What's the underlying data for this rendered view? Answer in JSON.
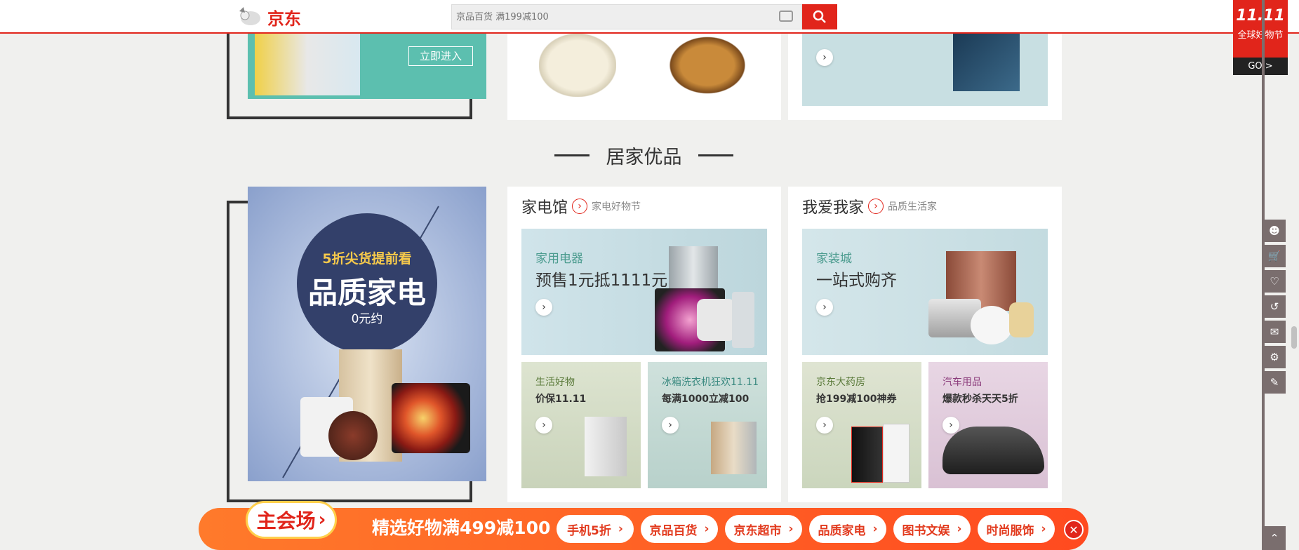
{
  "header": {
    "logo_text": "京东",
    "search_placeholder": "京品百货 满199减100",
    "camera_icon": "camera-icon",
    "search_icon": "search-icon"
  },
  "promo_corner": {
    "label": "全球好物节",
    "go": "GO >",
    "badge": "11.11"
  },
  "top_banner": {
    "enter_label": "立即进入"
  },
  "section": {
    "title": "居家优品"
  },
  "left_banner": {
    "line1": "5折尖货提前看",
    "line2": "品质家电",
    "line3": "0元约"
  },
  "panel_appliance": {
    "title": "家电馆",
    "subtitle": "家电好物节",
    "main": {
      "cat": "家用电器",
      "headline": "预售1元抵1111元"
    },
    "tiles": [
      {
        "cat": "生活好物",
        "headline": "价保11.11"
      },
      {
        "cat": "冰箱洗衣机狂欢11.11",
        "headline": "每满1000立减100"
      }
    ]
  },
  "panel_home": {
    "title": "我爱我家",
    "subtitle": "品质生活家",
    "main": {
      "cat": "家装城",
      "headline": "一站式购齐"
    },
    "tiles": [
      {
        "cat": "京东大药房",
        "headline": "抢199减100神券"
      },
      {
        "cat": "汽车用品",
        "headline": "爆款秒杀天天5折"
      }
    ]
  },
  "bottom_bar": {
    "main_venue": "主会场",
    "promo": "精选好物满499减100",
    "links": [
      "手机5折",
      "京品百货",
      "京东超市",
      "品质家电",
      "图书文娱",
      "时尚服饰"
    ],
    "close_icon": "close-icon"
  },
  "right_rail": [
    "user-icon",
    "cart-icon",
    "heart-icon",
    "history-icon",
    "message-icon",
    "service-icon",
    "feedback-icon"
  ],
  "colors": {
    "brand_red": "#e1251b",
    "page_bg": "#f0f0ee",
    "rail_gray": "#7a6e6e",
    "bar_orange": "#ff5a1f"
  }
}
